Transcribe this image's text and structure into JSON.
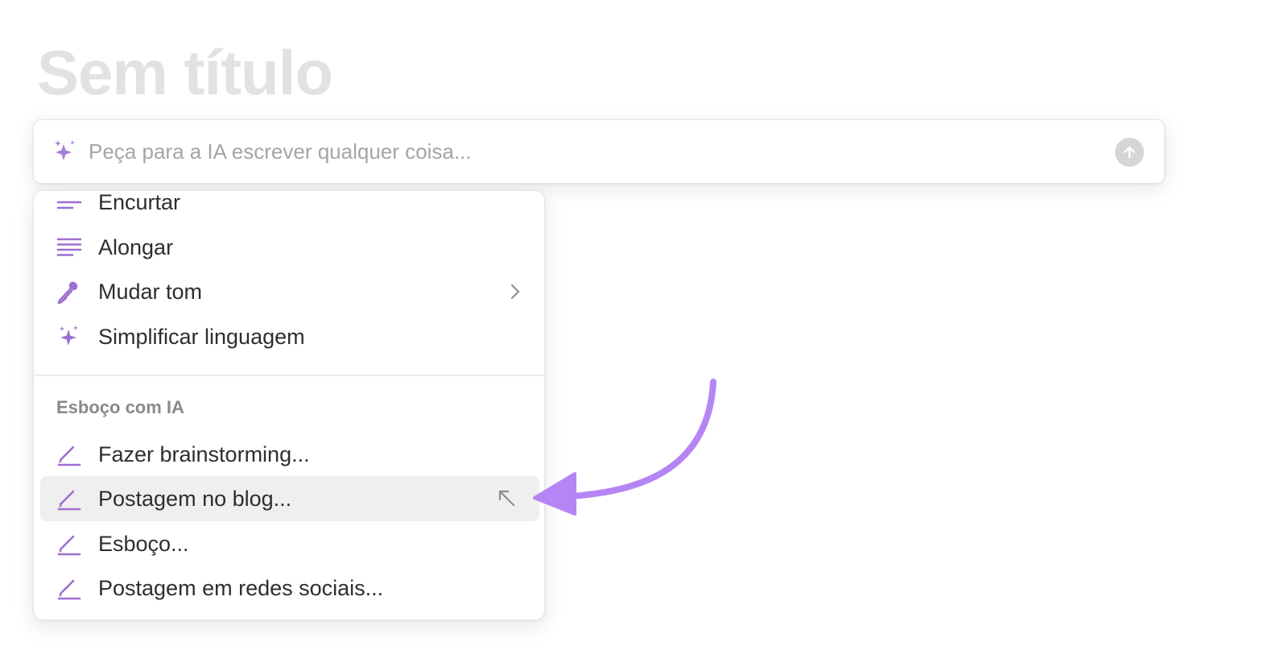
{
  "page": {
    "title": "Sem título"
  },
  "ai_bar": {
    "placeholder": "Peça para a IA escrever qualquer coisa...",
    "value": "",
    "icon": "sparkles-icon",
    "submit_icon": "arrow-up-icon"
  },
  "menu": {
    "edit_items": [
      {
        "label": "Encurtar",
        "icon": "shorten-lines-icon"
      },
      {
        "label": "Alongar",
        "icon": "lengthen-lines-icon"
      },
      {
        "label": "Mudar tom",
        "icon": "microphone-icon",
        "has_submenu": true
      },
      {
        "label": "Simplificar linguagem",
        "icon": "sparkles-icon"
      }
    ],
    "draft_section": {
      "header": "Esboço com IA",
      "items": [
        {
          "label": "Fazer brainstorming...",
          "icon": "pen-icon"
        },
        {
          "label": "Postagem no blog...",
          "icon": "pen-icon",
          "hovered": true,
          "shortcut_icon": "enter-arrow-icon"
        },
        {
          "label": "Esboço...",
          "icon": "pen-icon"
        },
        {
          "label": "Postagem em redes sociais...",
          "icon": "pen-icon"
        }
      ]
    }
  },
  "colors": {
    "accent": "#9d6fd0",
    "annotation_arrow": "#b585f5",
    "hover_bg": "#efefef",
    "title_placeholder": "#e3e2e0"
  }
}
